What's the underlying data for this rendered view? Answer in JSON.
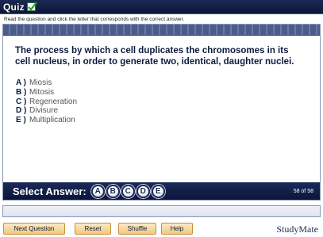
{
  "header": {
    "title": "Quiz",
    "icon": "checkbox-check-icon"
  },
  "instructions": "Read the question and click the letter that corresponds with the correct answer.",
  "question": "The process by which a cell duplicates the chromosomes in its cell nucleus, in order to generate two, identical, daughter nuclei.",
  "choices": [
    {
      "letter": "A )",
      "text": "Miosis"
    },
    {
      "letter": "B )",
      "text": "Mitosis"
    },
    {
      "letter": "C )",
      "text": "Regeneration"
    },
    {
      "letter": "D )",
      "text": "Divisure"
    },
    {
      "letter": "E )",
      "text": "Multiplication"
    }
  ],
  "answer_bar": {
    "label": "Select Answer:",
    "buttons": [
      "A",
      "B",
      "C",
      "D",
      "E"
    ],
    "counter": "58 of 58"
  },
  "footer": {
    "next_label": "Next Question",
    "reset_label": "Reset",
    "shuffle_label": "Shuffle",
    "help_label": "Help",
    "logo": "StudyMate"
  },
  "colors": {
    "title_bg": "#0b1636",
    "button_fill": "#f2c97e",
    "button_border": "#c9903a",
    "question_text": "#0d1b3e"
  }
}
